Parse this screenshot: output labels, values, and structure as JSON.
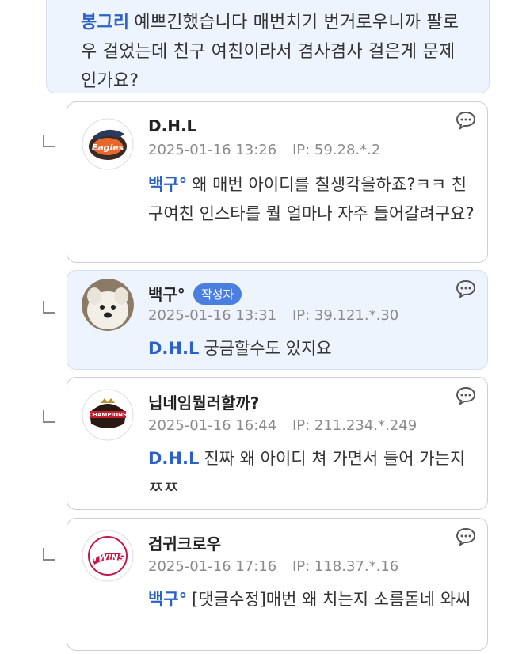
{
  "top_comment": {
    "mention": "봉그리",
    "text": "예쁘긴했습니다 매번치기 번거로우니까 팔로우 걸었는데 친구 여친이라서 겸사겸사 걸은게 문제인가요?"
  },
  "comments": [
    {
      "nick": "D.H.L",
      "badge": "",
      "date": "2025-01-16 13:26",
      "ip_label": "IP:",
      "ip": "59.28.*.2",
      "mention": "백구°",
      "text": "왜 매번 아이디를 칠생각을하죠?ㅋㅋ 친구여친 인스타를 뭘 얼마나 자주 들어갈려구요?",
      "avatar_icon": "eagles-logo-icon"
    },
    {
      "nick": "백구°",
      "badge": "작성자",
      "date": "2025-01-16 13:31",
      "ip_label": "IP:",
      "ip": "39.121.*.30",
      "mention": "D.H.L",
      "text": "궁금할수도 있지요",
      "avatar_icon": "dog-photo-icon"
    },
    {
      "nick": "닙네임뭘러할까?",
      "badge": "",
      "date": "2025-01-16 16:44",
      "ip_label": "IP:",
      "ip": "211.234.*.249",
      "mention": "D.H.L",
      "text": "진짜 왜 아이디 쳐 가면서 들어 가는지 ㅉㅉ",
      "avatar_icon": "champions-logo-icon"
    },
    {
      "nick": "검귀크로우",
      "badge": "",
      "date": "2025-01-16 17:16",
      "ip_label": "IP:",
      "ip": "118.37.*.16",
      "mention": "백구°",
      "text": "[댓글수정]매번 왜 치는지 소름돋네 와씨",
      "avatar_icon": "twins-logo-icon"
    }
  ],
  "colors": {
    "mention": "#2b62c7",
    "badge": "#4a7fe0",
    "author_bg": "#eef4fd"
  }
}
